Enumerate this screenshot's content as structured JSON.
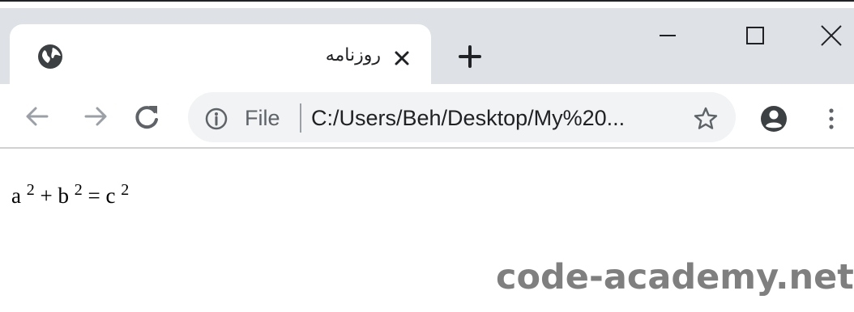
{
  "colors": {
    "tabstrip": "#dee1e6",
    "tab_active": "#ffffff",
    "omnibox": "#f1f3f4",
    "icon": "#5f6368",
    "watermark": "#7f7f7f"
  },
  "tab": {
    "title": "روزنامه",
    "favicon": "globe-icon",
    "close_icon": "close-icon"
  },
  "tabstrip": {
    "new_tab_icon": "plus-icon"
  },
  "window_controls": [
    "minimize-icon",
    "maximize-icon",
    "close-icon"
  ],
  "toolbar": {
    "back_icon": "arrow-left-icon",
    "forward_icon": "arrow-right-icon",
    "reload_icon": "reload-icon",
    "info_icon": "info-icon",
    "scheme_label": "File",
    "url": "C:/Users/Beh/Desktop/My%20...",
    "bookmark_icon": "star-icon",
    "profile_icon": "account-icon",
    "menu_icon": "more-vert-icon"
  },
  "page": {
    "formula": {
      "a": "a",
      "a_exp": "2",
      "plus": "+",
      "b": "b",
      "b_exp": "2",
      "equals": "=",
      "c": "c",
      "c_exp": "2"
    }
  },
  "watermark": "code-academy.net"
}
